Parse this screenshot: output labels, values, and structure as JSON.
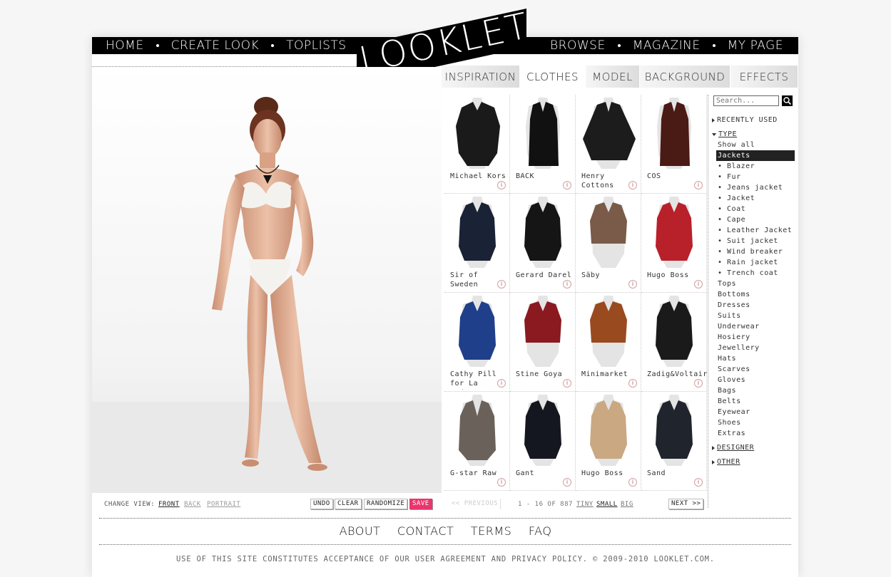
{
  "nav": {
    "left": [
      "HOME",
      "CREATE LOOK",
      "TOPLISTS"
    ],
    "right": [
      "BROWSE",
      "MAGAZINE",
      "MY PAGE"
    ]
  },
  "logo": {
    "text": "LOOKLET"
  },
  "tabs": [
    {
      "label": "INSPIRATION",
      "active": false
    },
    {
      "label": "CLOTHES",
      "active": true
    },
    {
      "label": "MODEL",
      "active": false
    },
    {
      "label": "BACKGROUND",
      "active": false
    },
    {
      "label": "EFFECTS",
      "active": false
    }
  ],
  "items": [
    {
      "name": "Michael Kors",
      "color": "#1a1a1a",
      "style": "fur"
    },
    {
      "name": "BACK",
      "color": "#111111",
      "style": "coat"
    },
    {
      "name": "Henry Cottons",
      "color": "#1c1c1c",
      "style": "cape"
    },
    {
      "name": "COS",
      "color": "#4a1a15",
      "style": "coat"
    },
    {
      "name": "Sir of Sweden",
      "color": "#1a2235",
      "style": "blazer"
    },
    {
      "name": "Gerard Darel",
      "color": "#151515",
      "style": "blazer"
    },
    {
      "name": "Säby",
      "color": "#7a5a48",
      "style": "cropped"
    },
    {
      "name": "Hugo Boss",
      "color": "#b8202a",
      "style": "blazer"
    },
    {
      "name": "Cathy Pill for La Redoute",
      "color": "#1f3f8a",
      "style": "blazer"
    },
    {
      "name": "Stine Goya",
      "color": "#8a1a1f",
      "style": "cropped"
    },
    {
      "name": "Minimarket",
      "color": "#9a4a1f",
      "style": "cropped"
    },
    {
      "name": "Zadig&Voltaire",
      "color": "#1a1a1a",
      "style": "blazer"
    },
    {
      "name": "G-star Raw",
      "color": "#6a625a",
      "style": "cardigan"
    },
    {
      "name": "Gant",
      "color": "#151720",
      "style": "blazer"
    },
    {
      "name": "Hugo Boss",
      "color": "#c9a882",
      "style": "blazer"
    },
    {
      "name": "Sand",
      "color": "#20252d",
      "style": "blazer"
    }
  ],
  "sidebar": {
    "search_placeholder": "Search...",
    "recently_used": "RECENTLY USED",
    "type": "TYPE",
    "type_items": [
      {
        "label": "Show all",
        "active": false
      },
      {
        "label": "Jackets",
        "active": true
      },
      {
        "label": "• Blazer",
        "active": false
      },
      {
        "label": "• Fur",
        "active": false
      },
      {
        "label": "• Jeans jacket",
        "active": false
      },
      {
        "label": "• Jacket",
        "active": false
      },
      {
        "label": "• Coat",
        "active": false
      },
      {
        "label": "• Cape",
        "active": false
      },
      {
        "label": "• Leather Jacket",
        "active": false
      },
      {
        "label": "• Suit jacket",
        "active": false
      },
      {
        "label": "• Wind breaker",
        "active": false
      },
      {
        "label": "• Rain jacket",
        "active": false
      },
      {
        "label": "• Trench coat",
        "active": false
      },
      {
        "label": "Tops",
        "active": false
      },
      {
        "label": "Bottoms",
        "active": false
      },
      {
        "label": "Dresses",
        "active": false
      },
      {
        "label": "Suits",
        "active": false
      },
      {
        "label": "Underwear",
        "active": false
      },
      {
        "label": "Hosiery",
        "active": false
      },
      {
        "label": "Jewellery",
        "active": false
      },
      {
        "label": "Hats",
        "active": false
      },
      {
        "label": "Scarves",
        "active": false
      },
      {
        "label": "Gloves",
        "active": false
      },
      {
        "label": "Bags",
        "active": false
      },
      {
        "label": "Belts",
        "active": false
      },
      {
        "label": "Eyewear",
        "active": false
      },
      {
        "label": "Shoes",
        "active": false
      },
      {
        "label": "Extras",
        "active": false
      }
    ],
    "designer": "DESIGNER",
    "other": "OTHER"
  },
  "view": {
    "label": "CHANGE VIEW:",
    "front": "FRONT",
    "back": "BACK",
    "portrait": "PORTRAIT"
  },
  "actions": {
    "undo": "UNDO",
    "clear": "CLEAR",
    "randomize": "RANDOMIZE",
    "save": "SAVE"
  },
  "pager": {
    "previous": "<< PREVIOUS",
    "range": "1 - 16 OF 887",
    "tiny": "TINY",
    "small": "SMALL",
    "big": "BIG",
    "next": "NEXT >>"
  },
  "footer": {
    "links": [
      "ABOUT",
      "CONTACT",
      "TERMS",
      "FAQ"
    ],
    "legal": "USE OF THIS SITE CONSTITUTES ACCEPTANCE OF OUR USER AGREEMENT AND PRIVACY POLICY. © 2009-2010 LOOKLET.COM."
  },
  "colors": {
    "accent": "#e9356e",
    "black": "#000000",
    "skin": "#e2b49a"
  }
}
